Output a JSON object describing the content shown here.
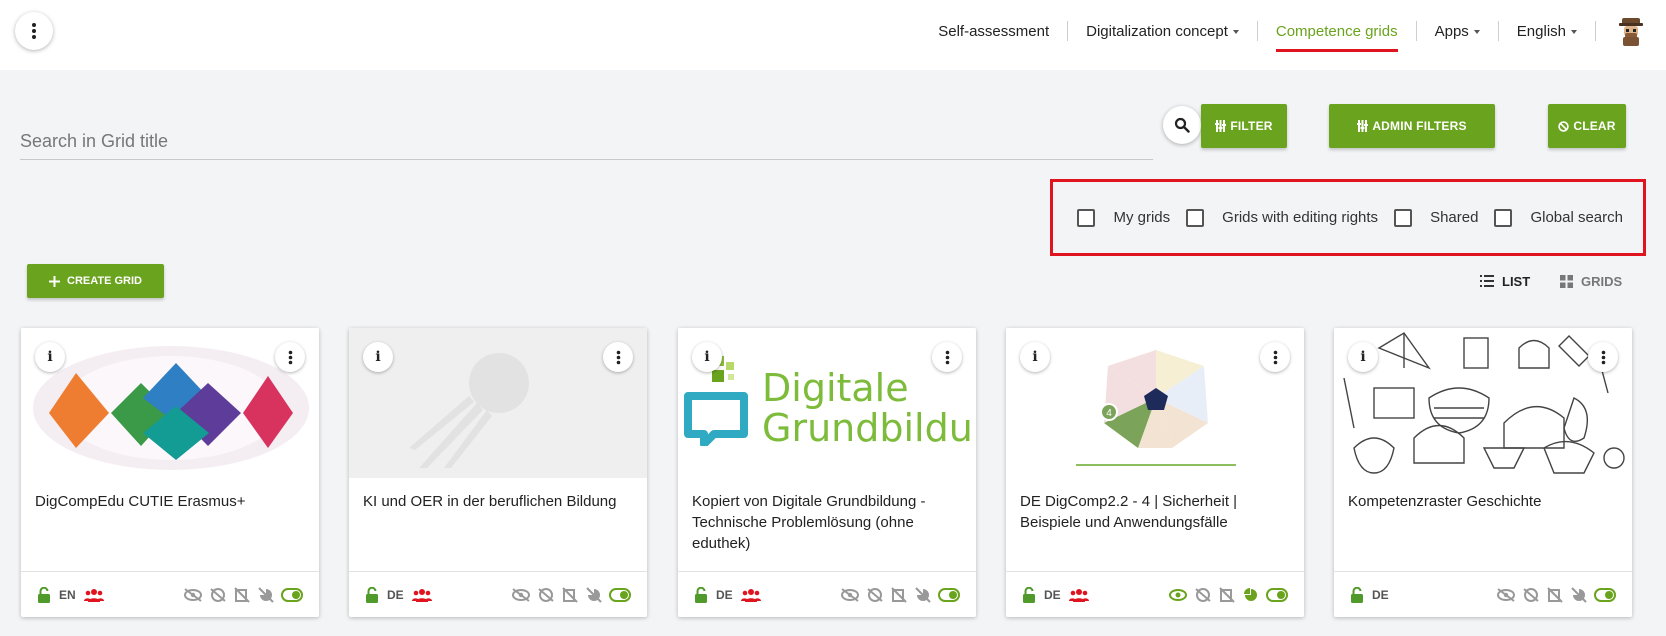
{
  "header": {
    "nav": {
      "self_assessment": "Self-assessment",
      "digitalization_concept": "Digitalization concept",
      "competence_grids": "Competence grids",
      "apps": "Apps",
      "language": "English"
    }
  },
  "search": {
    "placeholder": "Search in Grid title",
    "value": ""
  },
  "buttons": {
    "filter": "FILTER",
    "admin_filters": "ADMIN FILTERS",
    "clear": "CLEAR",
    "create_grid": "CREATE GRID"
  },
  "checkboxes": [
    {
      "label": "My grids",
      "checked": false
    },
    {
      "label": "Grids with editing rights",
      "checked": false
    },
    {
      "label": "Shared",
      "checked": false
    },
    {
      "label": "Global search",
      "checked": false
    }
  ],
  "view_toggle": {
    "list": "LIST",
    "grids": "GRIDS",
    "active": "list"
  },
  "cards": [
    {
      "title": "DigCompEdu CUTIE Erasmus+",
      "lang": "EN",
      "shared_group": true,
      "image": "digcompedu-diagram"
    },
    {
      "title": "KI und OER in der beruflichen Bildung",
      "lang": "DE",
      "shared_group": true,
      "image": "placeholder-comet"
    },
    {
      "title": "Kopiert von Digitale Grundbildung - Technische Problemlösung (ohne eduthek)",
      "lang": "DE",
      "shared_group": true,
      "image": "digitale-grundbildung-logo"
    },
    {
      "title": "DE DigComp2.2 - 4 | Sicherheit | Beispiele und Anwendungsfälle",
      "lang": "DE",
      "shared_group": true,
      "image": "pentagon-diagram"
    },
    {
      "title": "Kompetenzraster Geschichte",
      "lang": "DE",
      "shared_group": false,
      "image": "history-doodles"
    }
  ],
  "logo_text": {
    "digitale": "Digitale",
    "grundbildung": "Grundbildung"
  },
  "colors": {
    "accent_green": "#6aa31e",
    "highlight_red": "#e0141e",
    "share_red": "#e0141e"
  }
}
